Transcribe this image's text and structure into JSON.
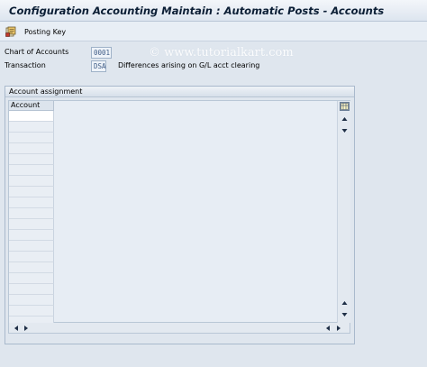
{
  "window": {
    "title": "Configuration Accounting Maintain : Automatic Posts - Accounts"
  },
  "toolbar": {
    "posting_key_label": "Posting Key"
  },
  "watermark": "© www.tutorialkart.com",
  "fields": {
    "chart_of_accounts": {
      "label": "Chart of Accounts",
      "value": "0001"
    },
    "transaction": {
      "label": "Transaction",
      "value": "DSA",
      "description": "Differences arising on G/L acct clearing"
    }
  },
  "account_assignment": {
    "title": "Account assignment",
    "columns": [
      "Account"
    ],
    "rows": [
      "",
      "",
      "",
      "",
      "",
      "",
      "",
      "",
      "",
      "",
      "",
      "",
      "",
      "",
      "",
      "",
      "",
      "",
      "",
      ""
    ]
  },
  "icons": {
    "posting_key": "posting-key-icon",
    "table_settings": "table-config-icon",
    "scroll_up": "scroll-up-arrow-icon",
    "scroll_down": "scroll-down-arrow-icon",
    "scroll_left": "scroll-left-arrow-icon",
    "scroll_right": "scroll-right-arrow-icon"
  },
  "colors": {
    "background": "#dfe6ee",
    "title_text": "#0b1e35",
    "field_text": "#3f5c86"
  }
}
